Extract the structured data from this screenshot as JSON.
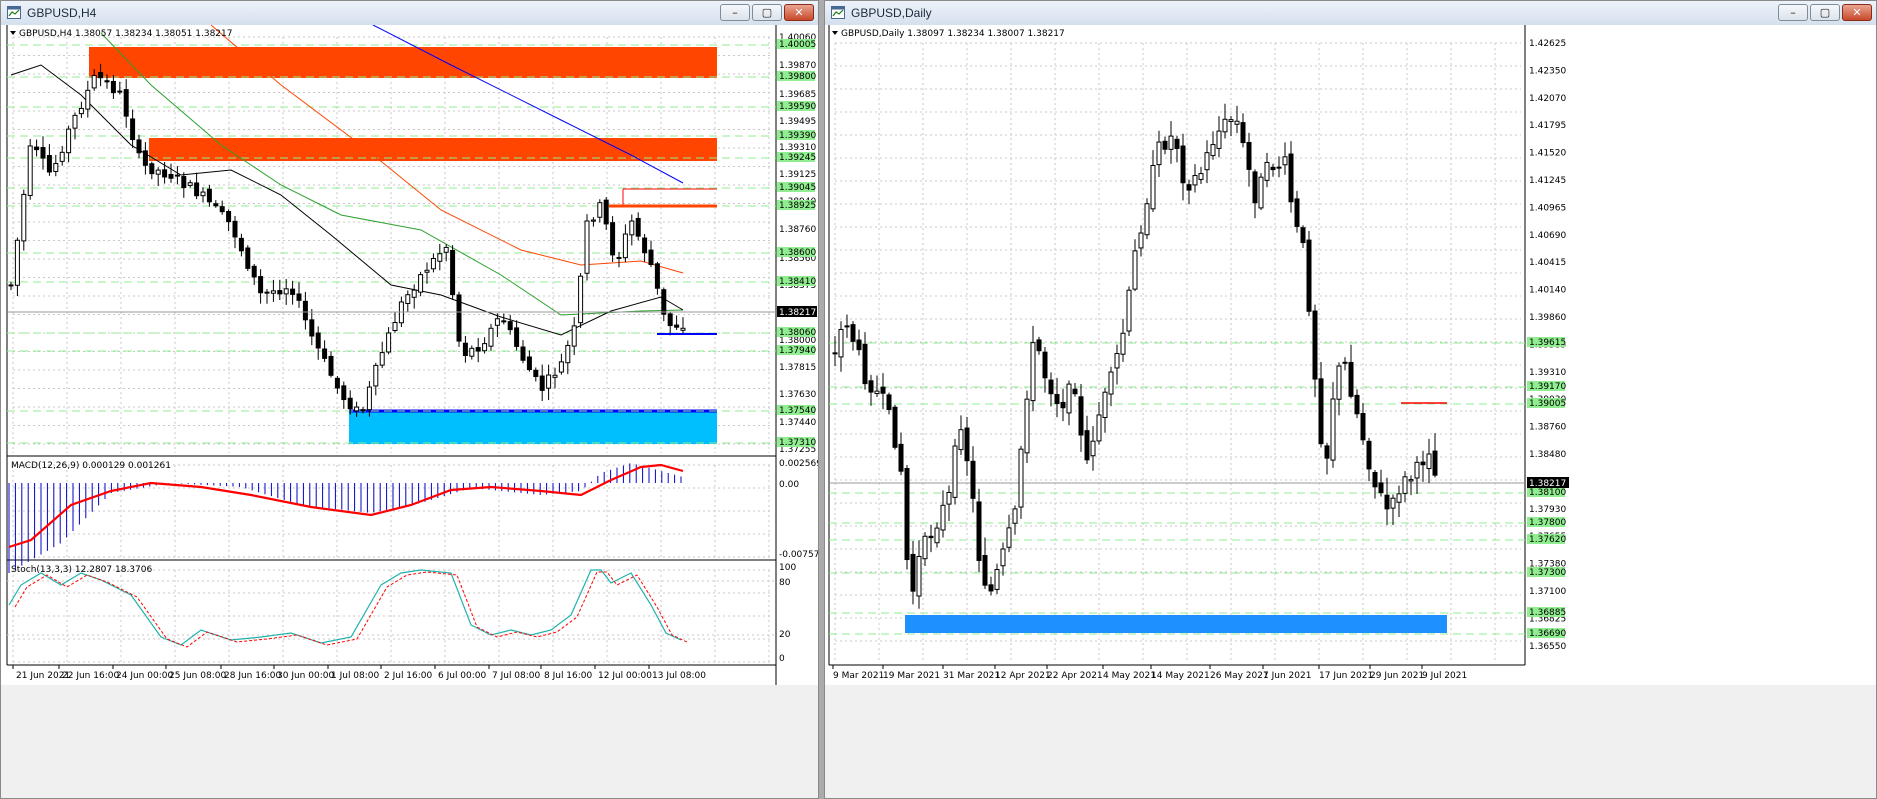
{
  "left": {
    "title": "GBPUSD,H4",
    "buttons": {
      "minimize": "–",
      "restore": "▢",
      "close": "✕"
    },
    "header": "GBPUSD,H4  1.38057 1.38234 1.38051 1.38217",
    "price_labels": [
      "1.40060",
      "1.39870",
      "1.39685",
      "1.39495",
      "1.39310",
      "1.39125",
      "1.38940",
      "1.38760",
      "1.38560",
      "1.38375",
      "1.38190",
      "1.38000",
      "1.37815",
      "1.37630",
      "1.37440",
      "1.37255"
    ],
    "level_labels": [
      "1.40005",
      "1.39800",
      "1.39590",
      "1.39390",
      "1.39245",
      "1.39045",
      "1.38925",
      "1.38600",
      "1.38410",
      "1.38060",
      "1.37940",
      "1.37540",
      "1.37310"
    ],
    "current_price": "1.38217",
    "time_labels": [
      "21 Jun 2021",
      "22 Jun 16:00",
      "24 Jun 00:00",
      "25 Jun 08:00",
      "28 Jun 16:00",
      "30 Jun 00:00",
      "1 Jul 08:00",
      "2 Jul 16:00",
      "6 Jul 00:00",
      "7 Jul 08:00",
      "8 Jul 16:00",
      "12 Jul 00:00",
      "13 Jul 08:00"
    ],
    "macd": {
      "label": "MACD(12,26,9) 0.000129 0.001261",
      "scale": [
        "0.002569",
        "0.00",
        "-0.007577"
      ]
    },
    "stoch": {
      "label": "Stoch(13,3,3) 12.2807 18.3706",
      "scale": [
        "100",
        "80",
        "20",
        "0"
      ]
    }
  },
  "right": {
    "title": "GBPUSD,Daily",
    "buttons": {
      "minimize": "–",
      "restore": "▢",
      "close": "✕"
    },
    "header": "GBPUSD,Daily  1.38097 1.38234 1.38007 1.38217",
    "price_labels": [
      "1.42625",
      "1.42350",
      "1.42070",
      "1.41795",
      "1.41520",
      "1.41245",
      "1.40965",
      "1.40690",
      "1.40415",
      "1.40140",
      "1.39860",
      "1.39585",
      "1.39310",
      "1.39030",
      "1.38760",
      "1.38480",
      "1.38205",
      "1.37930",
      "1.37655",
      "1.37380",
      "1.37100",
      "1.36825",
      "1.36550"
    ],
    "level_labels": [
      "1.39615",
      "1.39170",
      "1.39005",
      "1.38100",
      "1.37800",
      "1.37620",
      "1.37300",
      "1.36885",
      "1.36690"
    ],
    "current_price": "1.38217",
    "time_labels": [
      "9 Mar 2021",
      "19 Mar 2021",
      "31 Mar 2021",
      "12 Apr 2021",
      "22 Apr 2021",
      "4 May 2021",
      "14 May 2021",
      "26 May 2021",
      "7 Jun 2021",
      "17 Jun 2021",
      "29 Jun 2021",
      "9 Jul 2021"
    ]
  },
  "colors": {
    "zone_red": "#ff4500",
    "zone_blue": "#00bfff",
    "zone_blue_daily": "#1e90ff",
    "level_green": "#90ee90",
    "ma_blue": "#0000ff",
    "ma_red": "#ff4500",
    "ma_green": "#2ca02c",
    "line_red": "#ff0000",
    "macd_hist": "#0000cd",
    "stoch_main": "#20b2aa",
    "stoch_signal": "#ff0000"
  },
  "icons": {
    "window": "chart-window-icon"
  }
}
